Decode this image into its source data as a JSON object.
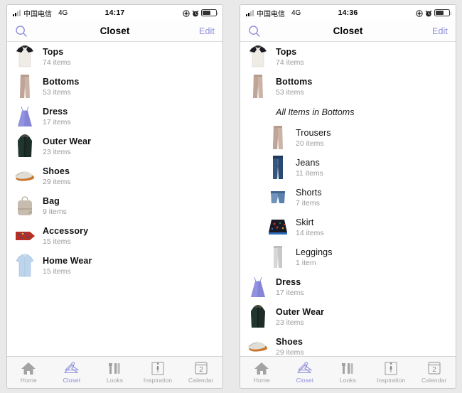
{
  "panels": [
    {
      "status": {
        "carrier": "中国电信",
        "network": "4G",
        "time": "14:17",
        "icons": [
          "location-icon",
          "alarm-icon",
          "battery-icon"
        ]
      },
      "nav": {
        "search_icon": "search-icon",
        "title": "Closet",
        "edit_label": "Edit"
      },
      "rows": [
        {
          "kind": "row",
          "title": "Tops",
          "subtitle": "74 items",
          "thumb": "tshirt-thumb"
        },
        {
          "kind": "row",
          "title": "Bottoms",
          "subtitle": "53 items",
          "thumb": "trousers-thumb"
        },
        {
          "kind": "row",
          "title": "Dress",
          "subtitle": "17 items",
          "thumb": "dress-thumb"
        },
        {
          "kind": "row",
          "title": "Outer Wear",
          "subtitle": "23 items",
          "thumb": "coat-thumb"
        },
        {
          "kind": "row",
          "title": "Shoes",
          "subtitle": "29 items",
          "thumb": "shoes-thumb"
        },
        {
          "kind": "row",
          "title": "Bag",
          "subtitle": "9 items",
          "thumb": "bag-thumb"
        },
        {
          "kind": "row",
          "title": "Accessory",
          "subtitle": "15 items",
          "thumb": "scarf-thumb"
        },
        {
          "kind": "row",
          "title": "Home Wear",
          "subtitle": "15 items",
          "thumb": "shirt-thumb"
        }
      ],
      "tabs": [
        {
          "label": "Home",
          "icon": "home-icon",
          "active": false
        },
        {
          "label": "Closet",
          "icon": "hangers-icon",
          "active": true
        },
        {
          "label": "Looks",
          "icon": "looks-icon",
          "active": false
        },
        {
          "label": "Inspiration",
          "icon": "inspiration-icon",
          "active": false
        },
        {
          "label": "Calendar",
          "icon": "calendar-icon",
          "active": false,
          "badge": "2"
        }
      ]
    },
    {
      "status": {
        "carrier": "中国电信",
        "network": "4G",
        "time": "14:36",
        "icons": [
          "location-icon",
          "alarm-icon",
          "battery-icon"
        ]
      },
      "nav": {
        "search_icon": "search-icon",
        "title": "Closet",
        "edit_label": "Edit"
      },
      "rows": [
        {
          "kind": "row",
          "title": "Tops",
          "subtitle": "74 items",
          "thumb": "tshirt-thumb"
        },
        {
          "kind": "row",
          "title": "Bottoms",
          "subtitle": "53 items",
          "thumb": "trousers-thumb"
        },
        {
          "kind": "header",
          "title": "All Items in Bottoms"
        },
        {
          "kind": "sub",
          "title": "Trousers",
          "subtitle": "20 items",
          "thumb": "trousers-thumb"
        },
        {
          "kind": "sub",
          "title": "Jeans",
          "subtitle": "11 items",
          "thumb": "jeans-thumb"
        },
        {
          "kind": "sub",
          "title": "Shorts",
          "subtitle": "7 items",
          "thumb": "shorts-thumb"
        },
        {
          "kind": "sub",
          "title": "Skirt",
          "subtitle": "14 items",
          "thumb": "skirt-thumb"
        },
        {
          "kind": "sub",
          "title": "Leggings",
          "subtitle": "1 item",
          "thumb": "leggings-thumb"
        },
        {
          "kind": "row",
          "title": "Dress",
          "subtitle": "17 items",
          "thumb": "dress-thumb"
        },
        {
          "kind": "row",
          "title": "Outer Wear",
          "subtitle": "23 items",
          "thumb": "coat-thumb"
        },
        {
          "kind": "row",
          "title": "Shoes",
          "subtitle": "29 items",
          "thumb": "shoes-thumb"
        }
      ],
      "tabs": [
        {
          "label": "Home",
          "icon": "home-icon",
          "active": false
        },
        {
          "label": "Closet",
          "icon": "hangers-icon",
          "active": true
        },
        {
          "label": "Looks",
          "icon": "looks-icon",
          "active": false
        },
        {
          "label": "Inspiration",
          "icon": "inspiration-icon",
          "active": false
        },
        {
          "label": "Calendar",
          "icon": "calendar-icon",
          "active": false,
          "badge": "2"
        }
      ]
    }
  ],
  "colors": {
    "accent": "#8e8edc",
    "title": "#111111",
    "subtitle": "#9a9a9a",
    "tab_inactive": "#a3a3a3",
    "panel_bg": "#ffffff",
    "page_bg": "#e9e9e9"
  }
}
